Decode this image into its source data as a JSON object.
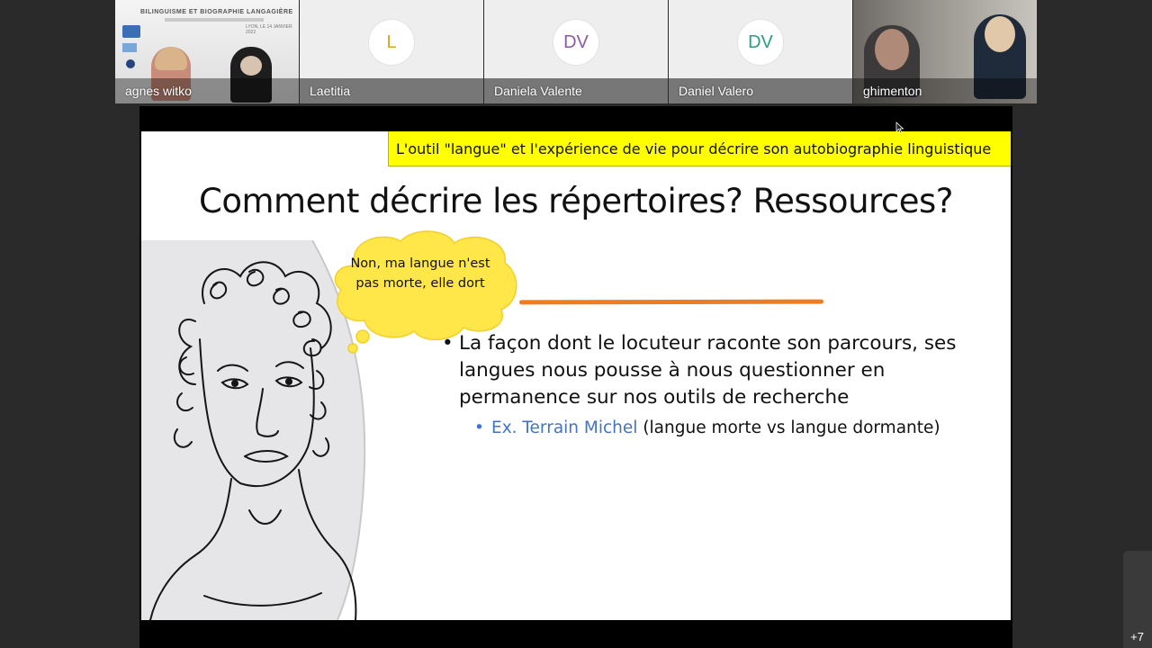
{
  "participants": [
    {
      "name": "agnes witko",
      "type": "video",
      "poster_title": "BILINGUISME ET BIOGRAPHIE LANGAGIÈRE",
      "poster_date": "LYON, LE 14 JANVIER 2022"
    },
    {
      "name": "Laetitia",
      "type": "avatar",
      "initials": "L",
      "initials_color": "#d9a621"
    },
    {
      "name": "Daniela Valente",
      "type": "avatar",
      "initials": "DV",
      "initials_color": "#8a5aa8"
    },
    {
      "name": "Daniel Valero",
      "type": "avatar",
      "initials": "DV",
      "initials_color": "#2a9c8a"
    },
    {
      "name": "ghimenton",
      "type": "video"
    }
  ],
  "overflow_count": "+7",
  "slide": {
    "banner": "L'outil \"langue\" et l'expérience de vie pour décrire son autobiographie linguistique",
    "banner_color": "#ffff00",
    "title": "Comment décrire les répertoires? Ressources?",
    "bubble_text": "Non, ma langue n'est pas morte, elle dort",
    "bubble_color": "#ffe74a",
    "accent_line_color": "#ee7d22",
    "bullet": "La façon dont le locuteur raconte son parcours, ses langues  nous pousse à nous questionner en permanence  sur nos outils de recherche",
    "sub_bullet_link": "Ex. Terrain Michel",
    "sub_bullet_rest": " (langue morte vs langue dormante)",
    "link_color": "#4472c4"
  }
}
